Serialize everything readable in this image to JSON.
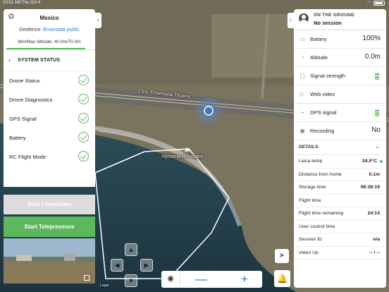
{
  "status_bar": {
    "time": "10:51 AM",
    "date": "Thu Oct 4"
  },
  "map": {
    "road_label": "Ctra. Ensenada-Tijuana",
    "area_label": "Nymeria Reloaded",
    "legal_label": "Legal",
    "colors": {
      "geofence": "#ffffff",
      "drone_dot": "#2f7ad6",
      "water": "#1f3b4a",
      "land": "#7d7660"
    }
  },
  "left_panel": {
    "location": "Mexico",
    "geofence_label": "Geofence:",
    "geofence_value": "Ensenada public",
    "altitude_label": "Min/Max Altitude:",
    "altitude_value": "40.0m/70.0m",
    "system_status_title": "SYSTEM STATUS",
    "status_items": [
      {
        "label": "Drone Status",
        "ok": true
      },
      {
        "label": "Drone Diagnostics",
        "ok": true
      },
      {
        "label": "GPS Signal",
        "ok": true
      },
      {
        "label": "Battery",
        "ok": true
      },
      {
        "label": "RC Flight Mode",
        "ok": true
      }
    ],
    "livestream_button": "Start Livestream",
    "telepresence_button": "Start Telepresence"
  },
  "right_panel": {
    "state_title": "ON THE GROUND",
    "session": "No session",
    "metrics": [
      {
        "icon": "battery-icon",
        "label": "Battery",
        "value": "100%"
      },
      {
        "icon": "altitude-icon",
        "label": "Altitude",
        "value": "0.0m"
      },
      {
        "icon": "signal-icon",
        "label": "Signal strength",
        "value": ""
      },
      {
        "icon": "play-icon",
        "label": "Web video",
        "value": ""
      },
      {
        "icon": "satellite-icon",
        "label": "GPS signal",
        "value": ""
      },
      {
        "icon": "camera-icon",
        "label": "Recording",
        "value": "No"
      }
    ],
    "details_title": "DETAILS",
    "details": [
      {
        "label": "Leica temp",
        "value": "24.0°C"
      },
      {
        "label": "Distance from home",
        "value": "0.1m"
      },
      {
        "label": "Storage time",
        "value": "06:39:19"
      },
      {
        "label": "Flight time",
        "value": ""
      },
      {
        "label": "Flight time remaining",
        "value": "24:14"
      },
      {
        "label": "User control time",
        "value": ""
      },
      {
        "label": "Session ID",
        "value": "n/a"
      },
      {
        "label": "Video Up",
        "value": "-- / --"
      }
    ],
    "signal_color": "#5cb85c"
  }
}
